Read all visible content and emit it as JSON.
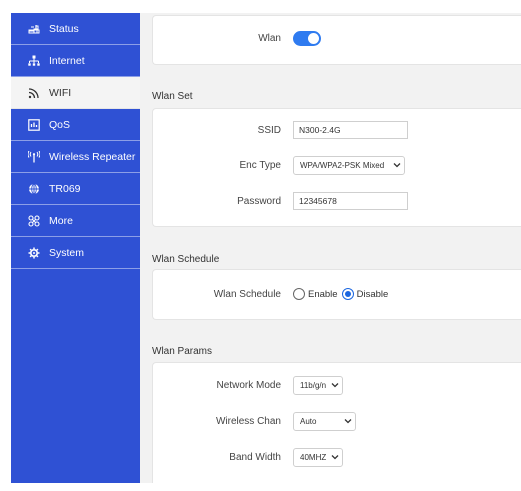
{
  "sidebar": {
    "items": [
      {
        "label": "Status",
        "icon": "status-icon"
      },
      {
        "label": "Internet",
        "icon": "network-icon"
      },
      {
        "label": "WIFI",
        "icon": "wifi-icon"
      },
      {
        "label": "QoS",
        "icon": "qos-icon"
      },
      {
        "label": "Wireless Repeater",
        "icon": "antenna-icon"
      },
      {
        "label": "TR069",
        "icon": "globe-icon"
      },
      {
        "label": "More",
        "icon": "more-icon"
      },
      {
        "label": "System",
        "icon": "gear-icon"
      }
    ],
    "active": "WIFI",
    "colors": {
      "background": "#2f51d4",
      "active_background": "#f4f4f4"
    }
  },
  "wlan": {
    "label": "Wlan",
    "enabled": true,
    "toggle_color": "#2f7bf0"
  },
  "wlan_set": {
    "title": "Wlan Set",
    "ssid_label": "SSID",
    "ssid_value": "N300-2.4G",
    "enc_label": "Enc Type",
    "enc_value": "WPA/WPA2-PSK Mixed",
    "password_label": "Password",
    "password_value": "12345678"
  },
  "wlan_schedule": {
    "title": "Wlan Schedule",
    "label": "Wlan Schedule",
    "enable_label": "Enable",
    "disable_label": "Disable",
    "selected": "Disable"
  },
  "wlan_params": {
    "title": "Wlan Params",
    "mode_label": "Network Mode",
    "mode_value": "11b/g/n",
    "chan_label": "Wireless Chan",
    "chan_value": "Auto",
    "bw_label": "Band Width",
    "bw_value": "40MHZ"
  }
}
